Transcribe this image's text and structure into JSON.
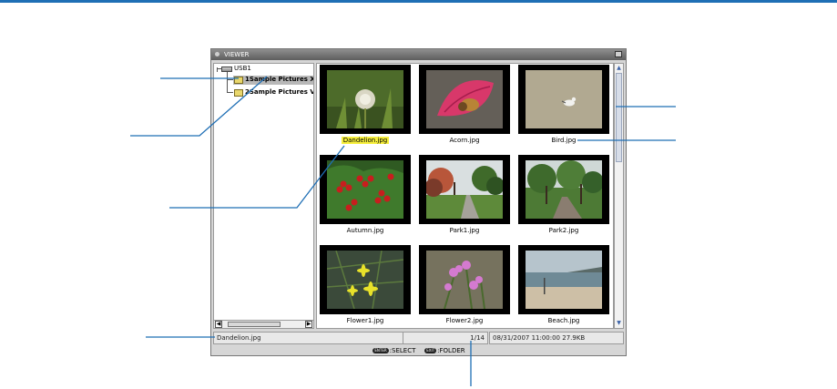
{
  "window": {
    "title": "VIEWER"
  },
  "tree": {
    "drive": "USB1",
    "folders": [
      "1Sample Pictures X",
      "2Sample Pictures V"
    ]
  },
  "thumbnails": [
    {
      "name": "Dandelion.jpg",
      "selected": true
    },
    {
      "name": "Acorn.jpg"
    },
    {
      "name": "Bird.jpg"
    },
    {
      "name": "Autumn.jpg"
    },
    {
      "name": "Park1.jpg"
    },
    {
      "name": "Park2.jpg"
    },
    {
      "name": "Flower1.jpg"
    },
    {
      "name": "Flower2.jpg"
    },
    {
      "name": "Beach.jpg"
    }
  ],
  "status": {
    "filename": "Dandelion.jpg",
    "page": "1/14",
    "datetime": "08/31/2007 11:00:00",
    "size": "27.9KB"
  },
  "footer": {
    "enter_key": "ENTER",
    "select_label": ":SELECT",
    "exit_key": "EXIT",
    "folder_label": ":FOLDER"
  },
  "colors": {
    "accent": "#1f6fb5",
    "highlight": "#f6ef3c"
  }
}
